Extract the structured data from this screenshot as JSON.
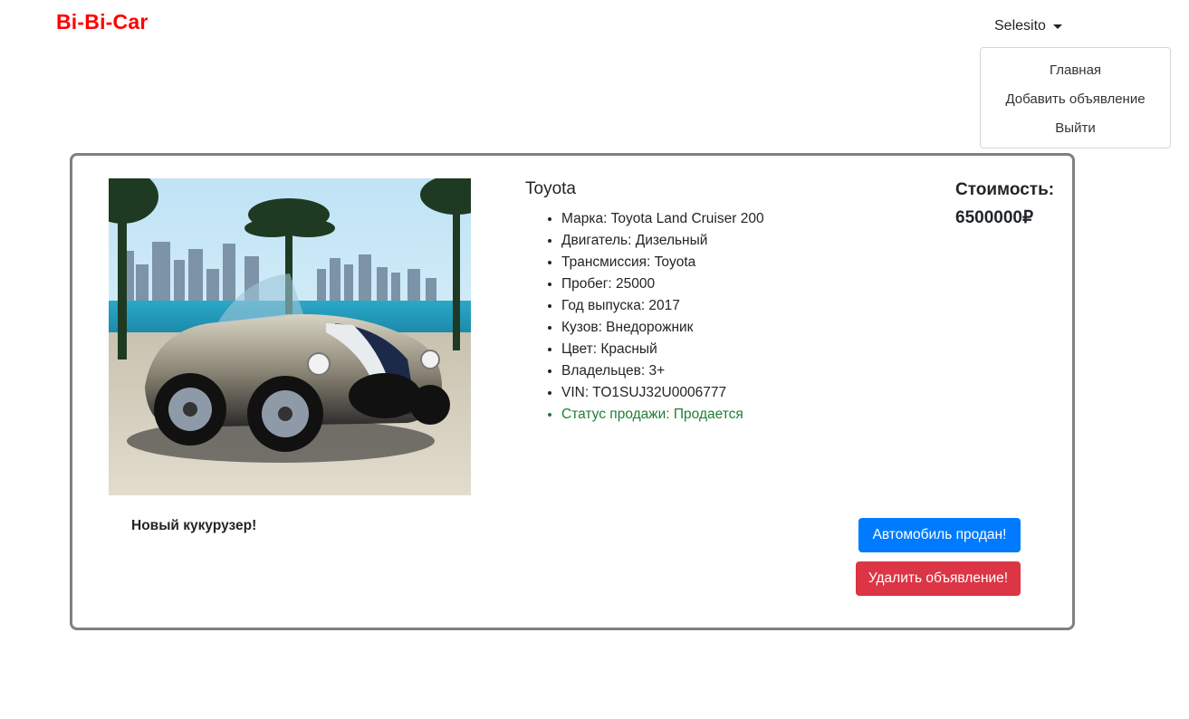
{
  "navbar": {
    "brand": "Bi-Bi-Car",
    "user": "Selesito",
    "menu": [
      "Главная",
      "Добавить объявление",
      "Выйти"
    ]
  },
  "listing": {
    "title": "Toyota",
    "specs": [
      "Марка: Toyota Land Cruiser 200",
      "Двигатель: Дизельный",
      "Трансмиссия: Toyota",
      "Пробег: 25000",
      "Год выпуска: 2017",
      "Кузов: Внедорожник",
      "Цвет: Красный",
      "Владельцев: 3+",
      "VIN: TO1SUJ32U0006777"
    ],
    "status": "Статус продажи: Продается",
    "price_label": "Стоимость:",
    "price": "6500000₽",
    "comment": "Новый кукурузер!",
    "image_icon": "car-photo"
  },
  "actions": {
    "sold": "Автомобиль продан!",
    "delete": "Удалить объявление!"
  },
  "colors": {
    "brand": "#ff0000",
    "primary": "#007bff",
    "danger": "#dc3545",
    "status": "#1e7e34",
    "card_border": "#808080"
  }
}
